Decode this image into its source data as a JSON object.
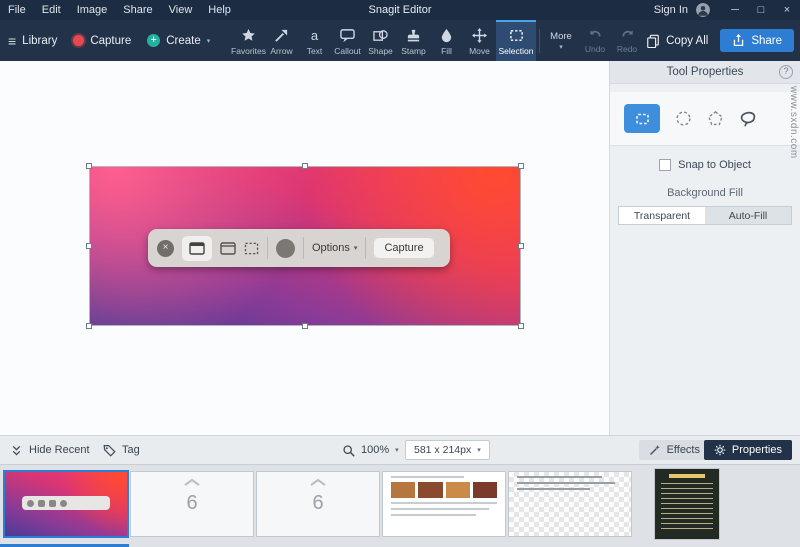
{
  "window": {
    "title": "Snagit Editor",
    "menu": [
      "File",
      "Edit",
      "Image",
      "Share",
      "View",
      "Help"
    ],
    "sign_in": "Sign In"
  },
  "icons": {
    "hamburger": "≡",
    "plus": "+",
    "caret_down": "▾",
    "minimize": "─",
    "maximize": "□",
    "close": "×",
    "help": "?"
  },
  "toolbar": {
    "library": "Library",
    "capture": "Capture",
    "create": "Create",
    "tools": [
      {
        "label": "Favorites"
      },
      {
        "label": "Arrow"
      },
      {
        "label": "Text"
      },
      {
        "label": "Callout"
      },
      {
        "label": "Shape"
      },
      {
        "label": "Stamp"
      },
      {
        "label": "Fill"
      },
      {
        "label": "Move"
      },
      {
        "label": "Selection"
      }
    ],
    "selected_tool": "Selection",
    "more": "More",
    "undo": "Undo",
    "redo": "Redo",
    "copy_all": "Copy All",
    "share": "Share"
  },
  "canvas": {
    "capture_toolbar": {
      "close": "×",
      "options": "Options",
      "capture": "Capture"
    }
  },
  "tool_properties": {
    "title": "Tool Properties",
    "snap_to_object": "Snap to Object",
    "background_fill": "Background Fill",
    "transparent": "Transparent",
    "auto_fill": "Auto-Fill"
  },
  "statusbar": {
    "hide_recent": "Hide Recent",
    "tag": "Tag",
    "zoom": "100%",
    "size": "581 x 214px",
    "effects": "Effects",
    "properties": "Properties"
  },
  "tray": {
    "stack_count": "6"
  },
  "watermark": "www.sxdn.com",
  "colors": {
    "navy": "#223349",
    "accent_blue": "#2d7ed3",
    "capture_red": "#e8484f",
    "create_teal": "#23b2a0",
    "selection_tile_blue": "#3f8edd"
  }
}
